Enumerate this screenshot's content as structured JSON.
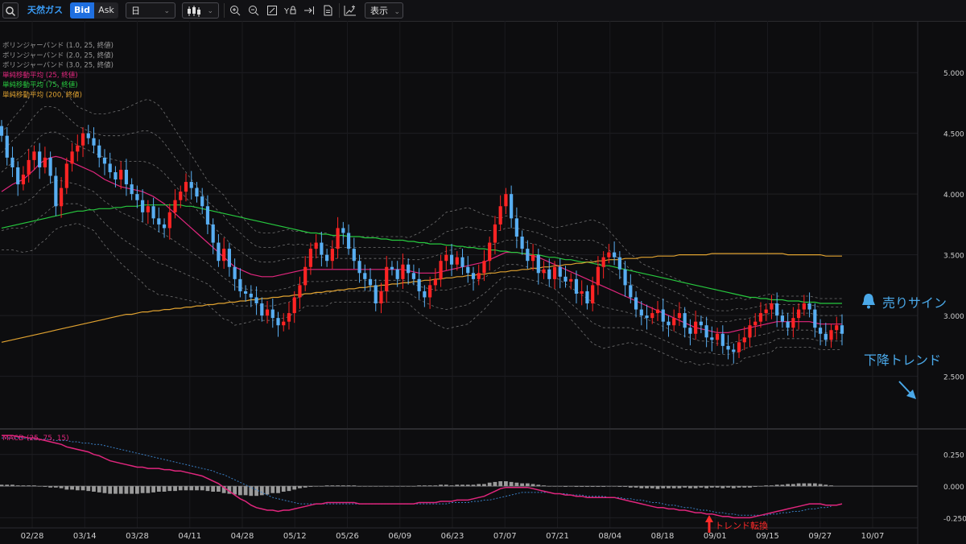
{
  "toolbar": {
    "search_icon": "search-icon",
    "symbol": "天然ガス",
    "bid_label": "Bid",
    "ask_label": "Ask",
    "timeframe": "日",
    "chart_type_icon": "candlestick-icon",
    "tools": [
      "zoom-in-icon",
      "zoom-out-icon",
      "fit-screen-icon",
      "y-axis-lock-icon",
      "scroll-to-end-icon",
      "document-icon"
    ],
    "indicator_icon": "add-indicator-icon",
    "display_label": "表示"
  },
  "legend": [
    {
      "text": "ボリンジャーバンド (1.0, 25, 終値)",
      "color": "#9a9a9a"
    },
    {
      "text": "ボリンジャーバンド (2.0, 25, 終値)",
      "color": "#9a9a9a"
    },
    {
      "text": "ボリンジャーバンド (3.0, 25, 終値)",
      "color": "#9a9a9a"
    },
    {
      "text": "単純移動平均 (25, 終値)",
      "color": "#e0267d"
    },
    {
      "text": "単純移動平均 (75, 終値)",
      "color": "#27c93f"
    },
    {
      "text": "単純移動平均 (200, 終値)",
      "color": "#e0a230"
    }
  ],
  "annotations": {
    "sell_sign": "売りサイン",
    "downtrend": "下降トレンド",
    "trend_reversal": "トレンド転換",
    "accent_color": "#4aa8e8",
    "reversal_color": "#ff2a2a"
  },
  "chart_data": [
    {
      "type": "candlestick",
      "x_ticks": [
        "02/28",
        "03/14",
        "03/28",
        "04/11",
        "04/28",
        "05/12",
        "05/26",
        "06/09",
        "06/23",
        "07/07",
        "07/21",
        "08/04",
        "08/18",
        "09/01",
        "09/15",
        "09/27",
        "10/07"
      ],
      "y_ticks": [
        "5.000",
        "4.500",
        "4.000",
        "3.500",
        "3.000",
        "2.500"
      ],
      "ylim": [
        2.1,
        5.2
      ],
      "colors": {
        "up": "#ff2424",
        "down": "#58aef2"
      },
      "closes": [
        4.48,
        4.3,
        4.22,
        4.08,
        4.16,
        4.28,
        4.35,
        4.22,
        4.3,
        4.15,
        3.9,
        4.05,
        4.25,
        4.35,
        4.4,
        4.5,
        4.46,
        4.4,
        4.3,
        4.25,
        4.18,
        4.12,
        4.2,
        4.08,
        4.0,
        3.95,
        3.85,
        3.9,
        3.8,
        3.75,
        3.72,
        3.85,
        3.95,
        4.02,
        4.1,
        4.05,
        3.98,
        3.9,
        3.75,
        3.6,
        3.45,
        3.55,
        3.4,
        3.3,
        3.2,
        3.18,
        3.15,
        3.1,
        3.0,
        3.05,
        2.98,
        2.92,
        2.95,
        3.02,
        3.15,
        3.25,
        3.4,
        3.55,
        3.6,
        3.5,
        3.45,
        3.55,
        3.72,
        3.68,
        3.55,
        3.45,
        3.35,
        3.3,
        3.25,
        3.1,
        3.2,
        3.4,
        3.38,
        3.3,
        3.42,
        3.35,
        3.3,
        3.2,
        3.15,
        3.25,
        3.3,
        3.45,
        3.5,
        3.42,
        3.48,
        3.4,
        3.35,
        3.3,
        3.35,
        3.45,
        3.6,
        3.75,
        3.9,
        4.0,
        3.8,
        3.65,
        3.55,
        3.45,
        3.5,
        3.35,
        3.38,
        3.3,
        3.4,
        3.32,
        3.28,
        3.3,
        3.18,
        3.2,
        3.1,
        3.25,
        3.4,
        3.48,
        3.52,
        3.48,
        3.38,
        3.25,
        3.15,
        3.05,
        3.0,
        2.98,
        3.02,
        3.05,
        2.95,
        2.92,
        2.98,
        3.02,
        2.9,
        2.85,
        2.95,
        2.92,
        2.82,
        2.8,
        2.85,
        2.75,
        2.72,
        2.7,
        2.78,
        2.82,
        2.92,
        2.95,
        3.02,
        3.05,
        3.1,
        3.0,
        2.95,
        2.9,
        2.98,
        3.05,
        3.1,
        3.05,
        2.9,
        2.85,
        2.8,
        2.88,
        2.92,
        2.85
      ],
      "sma25": [
        4.02,
        4.05,
        4.08,
        4.1,
        4.12,
        4.16,
        4.2,
        4.25,
        4.28,
        4.3,
        4.31,
        4.3,
        4.28,
        4.26,
        4.24,
        4.22,
        4.2,
        4.18,
        4.15,
        4.12,
        4.1,
        4.08,
        4.06,
        4.05,
        4.04,
        4.03,
        4.02,
        4.0,
        3.98,
        3.95,
        3.92,
        3.88,
        3.84,
        3.8,
        3.76,
        3.72,
        3.68,
        3.64,
        3.6,
        3.56,
        3.52,
        3.48,
        3.44,
        3.4,
        3.38,
        3.36,
        3.34,
        3.33,
        3.32,
        3.32,
        3.32,
        3.33,
        3.34,
        3.35,
        3.36,
        3.37,
        3.38,
        3.38,
        3.38,
        3.38,
        3.38,
        3.38,
        3.38,
        3.38,
        3.38,
        3.38,
        3.38,
        3.38,
        3.38,
        3.38,
        3.38,
        3.38,
        3.38,
        3.38,
        3.38,
        3.37,
        3.36,
        3.35,
        3.35,
        3.35,
        3.35,
        3.36,
        3.37,
        3.38,
        3.39,
        3.4,
        3.41,
        3.42,
        3.43,
        3.44,
        3.46,
        3.48,
        3.5,
        3.52,
        3.52,
        3.52,
        3.51,
        3.5,
        3.49,
        3.48,
        3.46,
        3.44,
        3.42,
        3.4,
        3.38,
        3.36,
        3.34,
        3.32,
        3.3,
        3.28,
        3.26,
        3.24,
        3.22,
        3.2,
        3.18,
        3.16,
        3.14,
        3.12,
        3.1,
        3.08,
        3.06,
        3.04,
        3.02,
        3.0,
        2.98,
        2.96,
        2.94,
        2.92,
        2.9,
        2.89,
        2.88,
        2.87,
        2.86,
        2.86,
        2.86,
        2.87,
        2.88,
        2.89,
        2.9,
        2.91,
        2.92,
        2.93,
        2.94,
        2.95,
        2.95,
        2.95,
        2.95,
        2.95,
        2.95,
        2.95,
        2.94,
        2.93,
        2.93,
        2.93,
        2.93,
        2.93
      ],
      "sma75": [
        3.72,
        3.73,
        3.74,
        3.75,
        3.76,
        3.77,
        3.78,
        3.79,
        3.8,
        3.81,
        3.82,
        3.83,
        3.84,
        3.85,
        3.86,
        3.86,
        3.87,
        3.87,
        3.88,
        3.88,
        3.88,
        3.89,
        3.89,
        3.9,
        3.9,
        3.9,
        3.91,
        3.91,
        3.91,
        3.91,
        3.91,
        3.91,
        3.91,
        3.91,
        3.9,
        3.9,
        3.89,
        3.88,
        3.87,
        3.86,
        3.85,
        3.84,
        3.83,
        3.82,
        3.81,
        3.8,
        3.79,
        3.78,
        3.77,
        3.76,
        3.75,
        3.74,
        3.73,
        3.72,
        3.71,
        3.7,
        3.69,
        3.68,
        3.68,
        3.67,
        3.67,
        3.66,
        3.66,
        3.66,
        3.65,
        3.65,
        3.65,
        3.64,
        3.64,
        3.64,
        3.63,
        3.63,
        3.62,
        3.62,
        3.62,
        3.61,
        3.61,
        3.6,
        3.6,
        3.59,
        3.59,
        3.59,
        3.58,
        3.58,
        3.57,
        3.57,
        3.56,
        3.56,
        3.55,
        3.55,
        3.54,
        3.54,
        3.53,
        3.53,
        3.52,
        3.52,
        3.51,
        3.51,
        3.5,
        3.5,
        3.49,
        3.48,
        3.48,
        3.47,
        3.46,
        3.46,
        3.45,
        3.44,
        3.44,
        3.43,
        3.42,
        3.41,
        3.41,
        3.4,
        3.39,
        3.38,
        3.37,
        3.36,
        3.35,
        3.34,
        3.33,
        3.32,
        3.31,
        3.3,
        3.29,
        3.28,
        3.27,
        3.26,
        3.25,
        3.24,
        3.23,
        3.22,
        3.21,
        3.2,
        3.19,
        3.18,
        3.17,
        3.16,
        3.15,
        3.15,
        3.14,
        3.14,
        3.13,
        3.13,
        3.13,
        3.12,
        3.12,
        3.12,
        3.11,
        3.11,
        3.11,
        3.1,
        3.1,
        3.1,
        3.1,
        3.1
      ],
      "sma200": [
        2.78,
        2.79,
        2.8,
        2.81,
        2.82,
        2.83,
        2.84,
        2.85,
        2.86,
        2.87,
        2.88,
        2.89,
        2.9,
        2.91,
        2.92,
        2.93,
        2.94,
        2.95,
        2.96,
        2.97,
        2.98,
        2.99,
        3.0,
        3.01,
        3.01,
        3.02,
        3.03,
        3.03,
        3.04,
        3.04,
        3.05,
        3.05,
        3.06,
        3.06,
        3.07,
        3.07,
        3.08,
        3.08,
        3.09,
        3.09,
        3.1,
        3.1,
        3.11,
        3.11,
        3.12,
        3.12,
        3.13,
        3.13,
        3.14,
        3.14,
        3.15,
        3.15,
        3.16,
        3.16,
        3.17,
        3.17,
        3.18,
        3.18,
        3.19,
        3.19,
        3.2,
        3.2,
        3.21,
        3.21,
        3.22,
        3.22,
        3.23,
        3.23,
        3.24,
        3.24,
        3.25,
        3.25,
        3.26,
        3.26,
        3.27,
        3.27,
        3.28,
        3.28,
        3.29,
        3.29,
        3.3,
        3.3,
        3.31,
        3.31,
        3.32,
        3.32,
        3.33,
        3.33,
        3.34,
        3.34,
        3.35,
        3.35,
        3.36,
        3.36,
        3.37,
        3.37,
        3.38,
        3.38,
        3.39,
        3.39,
        3.4,
        3.4,
        3.41,
        3.41,
        3.42,
        3.42,
        3.43,
        3.43,
        3.44,
        3.44,
        3.45,
        3.45,
        3.46,
        3.46,
        3.46,
        3.47,
        3.47,
        3.47,
        3.48,
        3.48,
        3.48,
        3.49,
        3.49,
        3.49,
        3.49,
        3.5,
        3.5,
        3.5,
        3.5,
        3.5,
        3.5,
        3.51,
        3.51,
        3.51,
        3.51,
        3.51,
        3.51,
        3.51,
        3.51,
        3.51,
        3.51,
        3.51,
        3.51,
        3.51,
        3.51,
        3.5,
        3.5,
        3.5,
        3.5,
        3.5,
        3.5,
        3.5,
        3.49,
        3.49,
        3.49,
        3.49
      ],
      "band_width_1sd": [
        0.16,
        0.17,
        0.18,
        0.19,
        0.2,
        0.21,
        0.22,
        0.22,
        0.22,
        0.21,
        0.2,
        0.19,
        0.18,
        0.17,
        0.16,
        0.16,
        0.16,
        0.16,
        0.17,
        0.18,
        0.19,
        0.2,
        0.21,
        0.22,
        0.23,
        0.24,
        0.25,
        0.26,
        0.26,
        0.26,
        0.25,
        0.24,
        0.23,
        0.22,
        0.21,
        0.2,
        0.19,
        0.18,
        0.17,
        0.17,
        0.17,
        0.17,
        0.16,
        0.16,
        0.15,
        0.14,
        0.13,
        0.12,
        0.12,
        0.12,
        0.12,
        0.12,
        0.12,
        0.12,
        0.11,
        0.11,
        0.1,
        0.1,
        0.1,
        0.1,
        0.1,
        0.09,
        0.09,
        0.09,
        0.09,
        0.09,
        0.09,
        0.09,
        0.09,
        0.09,
        0.09,
        0.09,
        0.09,
        0.09,
        0.09,
        0.09,
        0.1,
        0.11,
        0.12,
        0.13,
        0.14,
        0.15,
        0.16,
        0.16,
        0.16,
        0.16,
        0.16,
        0.15,
        0.14,
        0.13,
        0.12,
        0.11,
        0.1,
        0.1,
        0.1,
        0.1,
        0.1,
        0.1,
        0.1,
        0.1,
        0.1,
        0.1,
        0.1,
        0.11,
        0.12,
        0.13,
        0.14,
        0.15,
        0.16,
        0.17,
        0.17,
        0.17,
        0.16,
        0.15,
        0.14,
        0.13,
        0.12,
        0.12,
        0.11,
        0.11,
        0.11,
        0.11,
        0.11,
        0.11,
        0.11,
        0.11,
        0.11,
        0.1,
        0.1,
        0.1,
        0.09,
        0.09,
        0.09,
        0.09,
        0.09,
        0.09,
        0.09,
        0.08,
        0.08,
        0.08,
        0.08,
        0.08,
        0.08,
        0.07,
        0.07,
        0.07,
        0.07,
        0.07,
        0.07,
        0.07,
        0.07,
        0.07,
        0.07,
        0.07,
        0.07,
        0.07
      ],
      "price_ticks_note": "candles are drawn around closes"
    },
    {
      "type": "macd",
      "label": "MACD (25, 75, 15)",
      "y_ticks": [
        "0.250",
        "0.000",
        "-0.250"
      ],
      "ylim": [
        -0.33,
        0.42
      ],
      "macd": [
        0.4,
        0.4,
        0.4,
        0.39,
        0.39,
        0.38,
        0.38,
        0.37,
        0.36,
        0.35,
        0.34,
        0.33,
        0.31,
        0.3,
        0.29,
        0.28,
        0.27,
        0.25,
        0.24,
        0.22,
        0.2,
        0.19,
        0.18,
        0.17,
        0.16,
        0.15,
        0.15,
        0.14,
        0.14,
        0.14,
        0.13,
        0.13,
        0.12,
        0.12,
        0.11,
        0.1,
        0.09,
        0.08,
        0.06,
        0.04,
        0.02,
        -0.01,
        -0.04,
        -0.07,
        -0.1,
        -0.12,
        -0.15,
        -0.17,
        -0.18,
        -0.19,
        -0.19,
        -0.2,
        -0.19,
        -0.19,
        -0.18,
        -0.17,
        -0.16,
        -0.15,
        -0.14,
        -0.14,
        -0.13,
        -0.13,
        -0.13,
        -0.13,
        -0.13,
        -0.13,
        -0.14,
        -0.14,
        -0.14,
        -0.14,
        -0.14,
        -0.14,
        -0.14,
        -0.14,
        -0.14,
        -0.14,
        -0.14,
        -0.13,
        -0.13,
        -0.13,
        -0.13,
        -0.12,
        -0.12,
        -0.12,
        -0.11,
        -0.11,
        -0.11,
        -0.1,
        -0.09,
        -0.08,
        -0.06,
        -0.04,
        -0.02,
        -0.01,
        -0.01,
        -0.01,
        -0.01,
        -0.01,
        -0.02,
        -0.03,
        -0.04,
        -0.05,
        -0.06,
        -0.06,
        -0.07,
        -0.07,
        -0.08,
        -0.08,
        -0.09,
        -0.09,
        -0.09,
        -0.09,
        -0.09,
        -0.09,
        -0.1,
        -0.11,
        -0.12,
        -0.13,
        -0.14,
        -0.15,
        -0.16,
        -0.17,
        -0.17,
        -0.18,
        -0.18,
        -0.19,
        -0.19,
        -0.2,
        -0.21,
        -0.21,
        -0.22,
        -0.22,
        -0.23,
        -0.24,
        -0.24,
        -0.25,
        -0.25,
        -0.25,
        -0.25,
        -0.24,
        -0.23,
        -0.22,
        -0.21,
        -0.2,
        -0.19,
        -0.18,
        -0.17,
        -0.16,
        -0.15,
        -0.14,
        -0.14,
        -0.14,
        -0.15,
        -0.15,
        -0.15,
        -0.14
      ],
      "signal": [
        0.38,
        0.38,
        0.38,
        0.38,
        0.38,
        0.37,
        0.37,
        0.37,
        0.37,
        0.37,
        0.36,
        0.36,
        0.36,
        0.35,
        0.35,
        0.34,
        0.34,
        0.33,
        0.33,
        0.32,
        0.31,
        0.3,
        0.29,
        0.28,
        0.27,
        0.26,
        0.25,
        0.24,
        0.23,
        0.22,
        0.21,
        0.2,
        0.19,
        0.18,
        0.17,
        0.16,
        0.15,
        0.14,
        0.13,
        0.12,
        0.1,
        0.09,
        0.07,
        0.05,
        0.03,
        0.01,
        -0.01,
        -0.03,
        -0.05,
        -0.07,
        -0.09,
        -0.1,
        -0.11,
        -0.12,
        -0.13,
        -0.14,
        -0.14,
        -0.14,
        -0.14,
        -0.14,
        -0.14,
        -0.14,
        -0.14,
        -0.14,
        -0.14,
        -0.14,
        -0.14,
        -0.14,
        -0.14,
        -0.14,
        -0.14,
        -0.14,
        -0.14,
        -0.14,
        -0.14,
        -0.14,
        -0.14,
        -0.14,
        -0.14,
        -0.14,
        -0.14,
        -0.14,
        -0.14,
        -0.13,
        -0.13,
        -0.13,
        -0.13,
        -0.12,
        -0.12,
        -0.11,
        -0.11,
        -0.1,
        -0.09,
        -0.08,
        -0.07,
        -0.06,
        -0.05,
        -0.05,
        -0.05,
        -0.05,
        -0.05,
        -0.05,
        -0.06,
        -0.06,
        -0.06,
        -0.07,
        -0.07,
        -0.07,
        -0.08,
        -0.08,
        -0.08,
        -0.08,
        -0.09,
        -0.09,
        -0.09,
        -0.1,
        -0.1,
        -0.11,
        -0.11,
        -0.12,
        -0.13,
        -0.13,
        -0.14,
        -0.15,
        -0.15,
        -0.16,
        -0.17,
        -0.17,
        -0.18,
        -0.19,
        -0.19,
        -0.2,
        -0.21,
        -0.21,
        -0.22,
        -0.22,
        -0.23,
        -0.23,
        -0.23,
        -0.23,
        -0.23,
        -0.23,
        -0.22,
        -0.22,
        -0.21,
        -0.21,
        -0.2,
        -0.2,
        -0.19,
        -0.18,
        -0.18,
        -0.17,
        -0.17,
        -0.16
      ],
      "colors": {
        "macd": "#e0267d",
        "signal": "#3a7fc4",
        "histogram": "#9a9a9a"
      }
    }
  ]
}
